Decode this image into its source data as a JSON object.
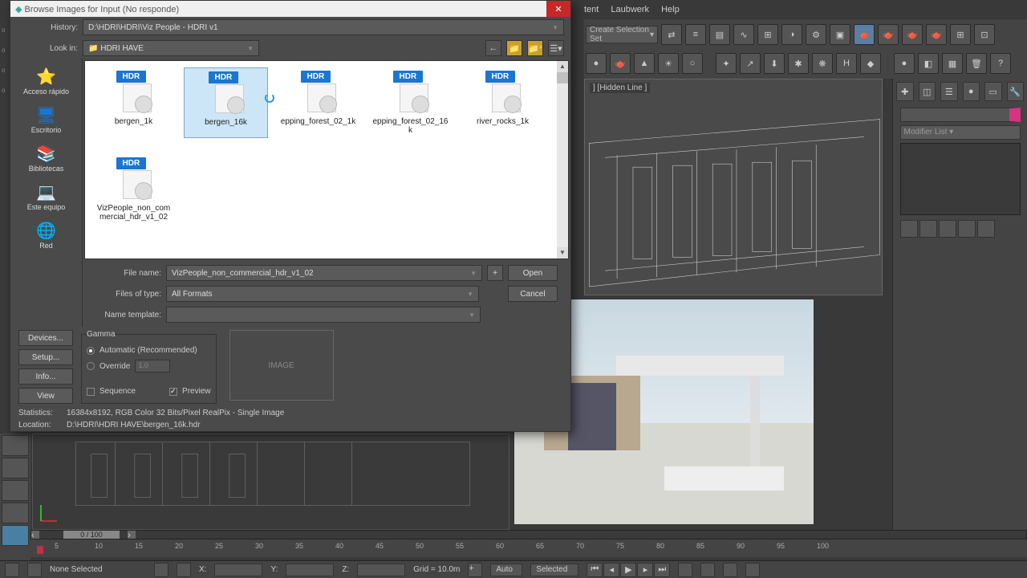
{
  "menubar": {
    "tent": "tent",
    "laubwerk": "Laubwerk",
    "help": "Help"
  },
  "selection_set_placeholder": "Create Selection Set",
  "viewport_wire_label": "] [Hidden Line ]",
  "cmd_panel": {
    "modifier_list": "Modifier List"
  },
  "timeline": {
    "knob": "0 / 100",
    "ticks": [
      "5",
      "10",
      "15",
      "20",
      "25",
      "30",
      "35",
      "40",
      "45",
      "50",
      "55",
      "60",
      "65",
      "70",
      "75",
      "80",
      "85",
      "90",
      "95",
      "100"
    ]
  },
  "status": {
    "none_selected": "None Selected",
    "x": "X:",
    "y": "Y:",
    "z": "Z:",
    "grid": "Grid = 10.0m",
    "auto": "Auto",
    "selected": "Selected"
  },
  "dialog": {
    "title": "Browse Images for Input (No responde)",
    "history_label": "History:",
    "history_value": "D:\\HDRI\\HDRI\\Viz People - HDRI v1",
    "lookin_label": "Look in:",
    "lookin_value": "HDRI HAVE",
    "places": [
      {
        "label": "Acceso rápido",
        "icon": "⭐",
        "color": "#2196f3"
      },
      {
        "label": "Escritorio",
        "icon": "🖥",
        "color": "#1976d2"
      },
      {
        "label": "Bibliotecas",
        "icon": "📚",
        "color": "#f9a825"
      },
      {
        "label": "Este equipo",
        "icon": "💻",
        "color": "#1976d2"
      },
      {
        "label": "Red",
        "icon": "🌐",
        "color": "#2196f3"
      }
    ],
    "files": [
      {
        "name": "bergen_1k",
        "selected": false
      },
      {
        "name": "bergen_16k",
        "selected": true,
        "loading": true
      },
      {
        "name": "epping_forest_02_1k",
        "selected": false
      },
      {
        "name": "epping_forest_02_16k",
        "selected": false
      },
      {
        "name": "river_rocks_1k",
        "selected": false
      },
      {
        "name": "VizPeople_non_commercial_hdr_v1_02",
        "selected": false,
        "row2": true
      }
    ],
    "filename_label": "File name:",
    "filename_value": "VizPeople_non_commercial_hdr_v1_02",
    "filetype_label": "Files of type:",
    "filetype_value": "All Formats",
    "nametpl_label": "Name template:",
    "open": "Open",
    "cancel": "Cancel",
    "plus": "+",
    "gamma_title": "Gamma",
    "gamma_auto": "Automatic (Recommended)",
    "gamma_override": "Override",
    "gamma_value": "1.0",
    "sequence": "Sequence",
    "preview": "Preview",
    "image_placeholder": "IMAGE",
    "devices": "Devices...",
    "setup": "Setup...",
    "info": "Info...",
    "view": "View",
    "stats_label": "Statistics:",
    "stats_value": "16384x8192, RGB Color 32 Bits/Pixel RealPix - Single Image",
    "loc_label": "Location:",
    "loc_value": "D:\\HDRI\\HDRI HAVE\\bergen_16k.hdr"
  }
}
